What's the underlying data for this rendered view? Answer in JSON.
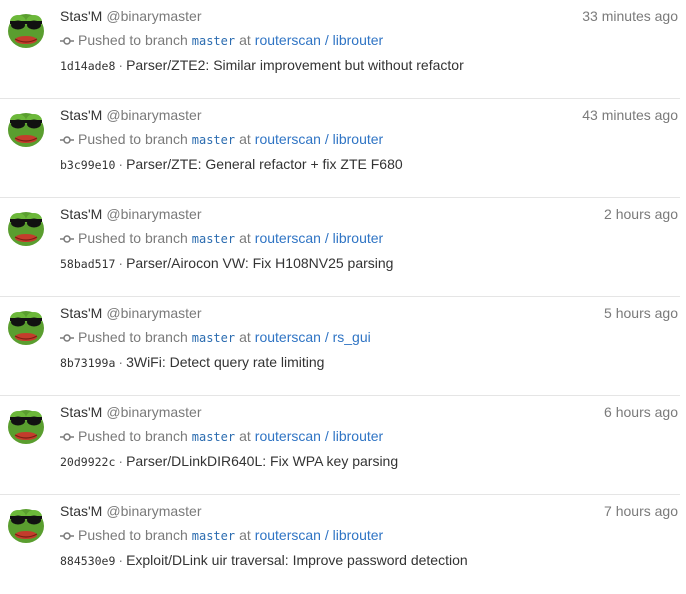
{
  "events": [
    {
      "user_name": "Stas'M",
      "user_handle": "@binarymaster",
      "timestamp": "33 minutes ago",
      "action": "Pushed to branch",
      "branch": "master",
      "at": "at",
      "repo": "routerscan / librouter",
      "sha": "1d14ade8",
      "separator": "·",
      "message": "Parser/ZTE2: Similar improvement but without refactor",
      "avatar_icon": "frog-sunglasses-avatar"
    },
    {
      "user_name": "Stas'M",
      "user_handle": "@binarymaster",
      "timestamp": "43 minutes ago",
      "action": "Pushed to branch",
      "branch": "master",
      "at": "at",
      "repo": "routerscan / librouter",
      "sha": "b3c99e10",
      "separator": "·",
      "message": "Parser/ZTE: General refactor + fix ZTE F680",
      "avatar_icon": "frog-sunglasses-avatar"
    },
    {
      "user_name": "Stas'M",
      "user_handle": "@binarymaster",
      "timestamp": "2 hours ago",
      "action": "Pushed to branch",
      "branch": "master",
      "at": "at",
      "repo": "routerscan / librouter",
      "sha": "58bad517",
      "separator": "·",
      "message": "Parser/Airocon VW: Fix H108NV25 parsing",
      "avatar_icon": "frog-sunglasses-avatar"
    },
    {
      "user_name": "Stas'M",
      "user_handle": "@binarymaster",
      "timestamp": "5 hours ago",
      "action": "Pushed to branch",
      "branch": "master",
      "at": "at",
      "repo": "routerscan / rs_gui",
      "sha": "8b73199a",
      "separator": "·",
      "message": "3WiFi: Detect query rate limiting",
      "avatar_icon": "frog-sunglasses-avatar"
    },
    {
      "user_name": "Stas'M",
      "user_handle": "@binarymaster",
      "timestamp": "6 hours ago",
      "action": "Pushed to branch",
      "branch": "master",
      "at": "at",
      "repo": "routerscan / librouter",
      "sha": "20d9922c",
      "separator": "·",
      "message": "Parser/DLinkDIR640L: Fix WPA key parsing",
      "avatar_icon": "frog-sunglasses-avatar"
    },
    {
      "user_name": "Stas'M",
      "user_handle": "@binarymaster",
      "timestamp": "7 hours ago",
      "action": "Pushed to branch",
      "branch": "master",
      "at": "at",
      "repo": "routerscan / librouter",
      "sha": "884530e9",
      "separator": "·",
      "message": "Exploit/DLink uir traversal: Improve password detection",
      "avatar_icon": "frog-sunglasses-avatar"
    }
  ]
}
